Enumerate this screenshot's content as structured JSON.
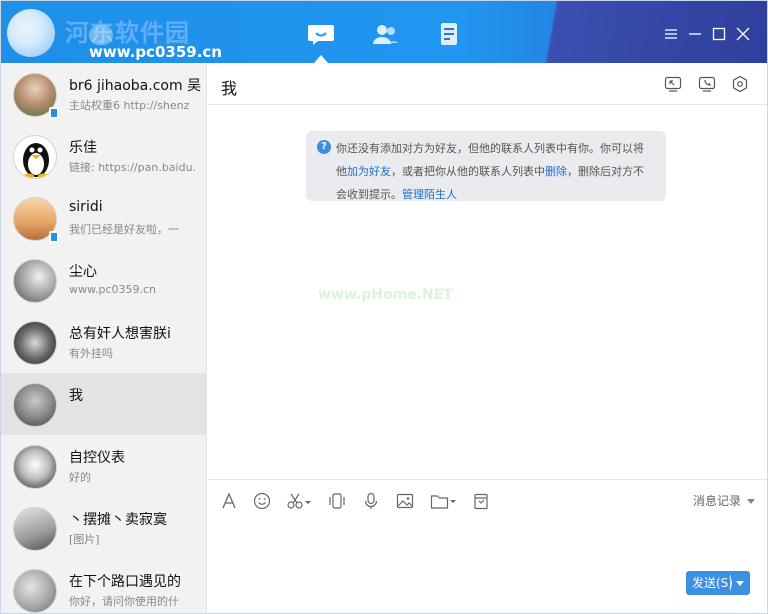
{
  "app": {
    "watermark_title": "河东软件园",
    "watermark_url": "www.pc0359.cn",
    "accent_color": "#2196f0"
  },
  "nav": {
    "icons": [
      "chat-icon",
      "contacts-icon",
      "files-icon"
    ],
    "window_controls": [
      "menu-icon",
      "minimize-icon",
      "maximize-icon",
      "close-icon"
    ]
  },
  "sidebar": {
    "conversations": [
      {
        "name": "br6 jihaoba.com 吴",
        "preview": "主站权重6  http://shenz",
        "phone_badge": true
      },
      {
        "name": "乐佳",
        "preview": "链接: https://pan.baidu.",
        "phone_badge": false
      },
      {
        "name": "siridi",
        "preview": "我们已经是好友啦，一",
        "phone_badge": true
      },
      {
        "name": "尘心",
        "preview": "www.pc0359.cn",
        "phone_badge": false
      },
      {
        "name": "总有奸人想害朕i",
        "preview": "有外挂吗",
        "phone_badge": false
      },
      {
        "name": "我",
        "preview": "",
        "phone_badge": false,
        "active": true
      },
      {
        "name": "自控仪表",
        "preview": "好的",
        "phone_badge": false
      },
      {
        "name": "丶摆摊丶卖寂寞",
        "preview": "[图片]",
        "phone_badge": false
      },
      {
        "name": "在下个路口遇见的",
        "preview": "你好，请问你使用的什",
        "phone_badge": false
      }
    ]
  },
  "chat": {
    "title": "我",
    "header_icons": [
      "share-screen-icon",
      "voice-call-icon",
      "settings-hex-icon"
    ],
    "notice": {
      "part1": "你还没有添加对方为好友，但他的联系人列表中有你。你可以将他",
      "link_add": "加为好友",
      "part2": "，或者把你从他的联系人列表中",
      "link_delete": "删除",
      "part3": "，删除后对方不会收到提示。",
      "link_manage": "管理陌生人"
    },
    "watermark": "www.pHome.NET",
    "toolbar": {
      "tools": [
        "font-icon",
        "emoji-icon",
        "screenshot-icon",
        "shake-icon",
        "voice-icon",
        "image-icon",
        "folder-icon",
        "clipboard-icon"
      ],
      "history_label": "消息记录"
    },
    "send_label": "发送(S)"
  }
}
